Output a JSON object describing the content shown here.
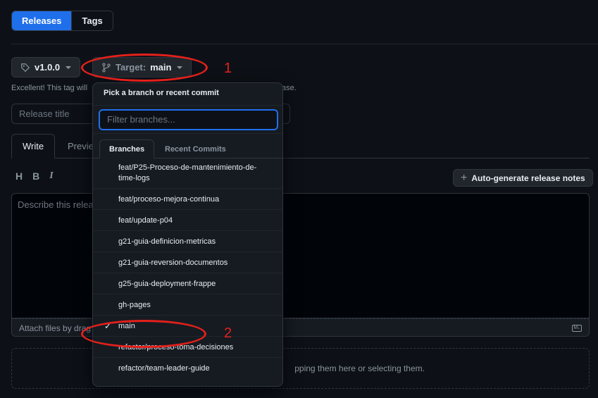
{
  "top_tabs": {
    "releases": "Releases",
    "tags": "Tags"
  },
  "tag_button": {
    "label": "v1.0.0"
  },
  "target_button": {
    "prefix": "Target:",
    "value": "main"
  },
  "helper": {
    "text": "Excellent! This tag will",
    "tail": "ase."
  },
  "release_title": {
    "placeholder": "Release title"
  },
  "editor": {
    "write": "Write",
    "preview": "Previe",
    "toolbar": [
      "H",
      "B",
      "I"
    ],
    "placeholder": "Describe this relea",
    "attach": "Attach files by drag",
    "md_icon": "markdown-icon"
  },
  "autogen": {
    "label": "Auto-generate release notes"
  },
  "dropzone": {
    "text": "pping them here or selecting them."
  },
  "menu": {
    "header": "Pick a branch or recent commit",
    "filter_placeholder": "Filter branches...",
    "tabs": {
      "branches": "Branches",
      "recent": "Recent Commits"
    },
    "branches": [
      {
        "name": "feat/P25-Proceso-de-mantenimiento-de-time-logs",
        "selected": false
      },
      {
        "name": "feat/proceso-mejora-continua",
        "selected": false
      },
      {
        "name": "feat/update-p04",
        "selected": false
      },
      {
        "name": "g21-guia-definicion-metricas",
        "selected": false
      },
      {
        "name": "g21-guia-reversion-documentos",
        "selected": false
      },
      {
        "name": "g25-guia-deployment-frappe",
        "selected": false
      },
      {
        "name": "gh-pages",
        "selected": false
      },
      {
        "name": "main",
        "selected": true
      },
      {
        "name": "refactor/proceso-toma-decisiones",
        "selected": false
      },
      {
        "name": "refactor/team-leader-guide",
        "selected": false
      }
    ]
  },
  "annotations": {
    "one": "1",
    "two": "2"
  },
  "colors": {
    "accent": "#1f6feb",
    "annotation": "#e3201b",
    "bg": "#0d1117"
  }
}
